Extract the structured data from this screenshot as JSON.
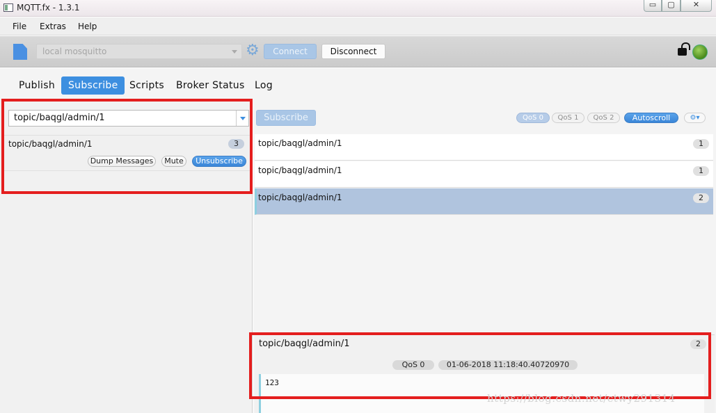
{
  "window": {
    "title": "MQTT.fx - 1.3.1",
    "min_glyph": "▭",
    "max_glyph": "▢",
    "close_glyph": "✕"
  },
  "menu": [
    "File",
    "Extras",
    "Help"
  ],
  "toolbar": {
    "connection_profile": "local mosquitto",
    "connect_label": "Connect",
    "disconnect_label": "Disconnect",
    "connected": true
  },
  "tabs": [
    "Publish",
    "Subscribe",
    "Scripts",
    "Broker Status",
    "Log"
  ],
  "active_tab": "Subscribe",
  "subscribe": {
    "topic_input": "topic/baqgl/admin/1",
    "subscribe_label": "Subscribe",
    "subscriptions": [
      {
        "topic": "topic/baqgl/admin/1",
        "count": "3",
        "dump_label": "Dump Messages",
        "mute_label": "Mute",
        "unsubscribe_label": "Unsubscribe"
      }
    ]
  },
  "qos_options": [
    "QoS 0",
    "QoS 1",
    "QoS 2"
  ],
  "autoscroll_label": "Autoscroll",
  "options_glyph": "⚙▾",
  "messages": [
    {
      "topic": "topic/baqgl/admin/1",
      "number": "1"
    },
    {
      "topic": "topic/baqgl/admin/1",
      "number": "1"
    },
    {
      "topic": "topic/baqgl/admin/1",
      "number": "2",
      "selected": true
    }
  ],
  "detail": {
    "topic": "topic/baqgl/admin/1",
    "number": "2",
    "qos": "QoS 0",
    "timestamp": "01-06-2018  11:18:40.40720970",
    "payload": "123"
  },
  "watermark": "https://blog.csdn.net/ctwy291314",
  "colors": {
    "accent": "#3d8fe0",
    "annotation": "#e41e1e",
    "selected_row": "#b0c4de",
    "connected_led": "#6fb23a"
  }
}
